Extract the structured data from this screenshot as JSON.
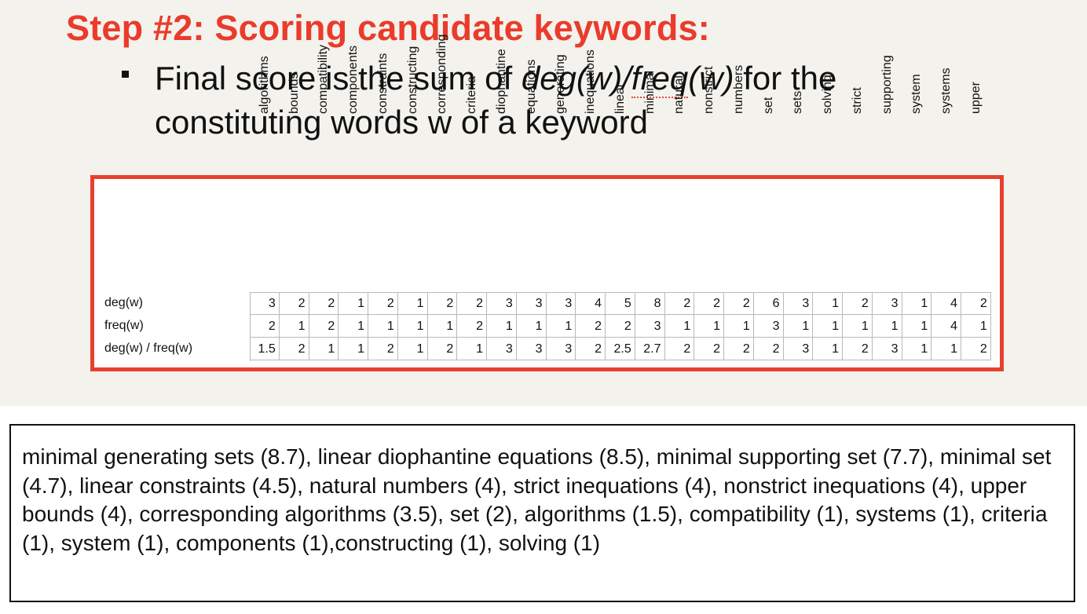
{
  "title": "Step #2: Scoring candidate keywords:",
  "bullet": {
    "prefix": "Final score is the sum of ",
    "formula_a": "deg(w)/",
    "formula_b": "freq",
    "formula_c": "(w)",
    "suffix_line1": " for the",
    "line2": "constituting words w of a keyword"
  },
  "table": {
    "row_labels": [
      "deg(w)",
      "freq(w)",
      "deg(w) / freq(w)"
    ],
    "columns": [
      "algorithms",
      "bounds",
      "compatibility",
      "components",
      "constraints",
      "constructing",
      "corresponding",
      "criteria",
      "diophantine",
      "equations",
      "generating",
      "inequations",
      "linear",
      "minimal",
      "natural",
      "nonstrict",
      "numbers",
      "set",
      "sets",
      "solving",
      "strict",
      "supporting",
      "system",
      "systems",
      "upper"
    ],
    "deg": [
      "3",
      "2",
      "2",
      "1",
      "2",
      "1",
      "2",
      "2",
      "3",
      "3",
      "3",
      "4",
      "5",
      "8",
      "2",
      "2",
      "2",
      "6",
      "3",
      "1",
      "2",
      "3",
      "1",
      "4",
      "2"
    ],
    "freq": [
      "2",
      "1",
      "2",
      "1",
      "1",
      "1",
      "1",
      "2",
      "1",
      "1",
      "1",
      "2",
      "2",
      "3",
      "1",
      "1",
      "1",
      "3",
      "1",
      "1",
      "1",
      "1",
      "1",
      "4",
      "1"
    ],
    "ratio": [
      "1.5",
      "2",
      "1",
      "1",
      "2",
      "1",
      "2",
      "1",
      "3",
      "3",
      "3",
      "2",
      "2.5",
      "2.7",
      "2",
      "2",
      "2",
      "2",
      "3",
      "1",
      "2",
      "3",
      "1",
      "1",
      "2"
    ]
  },
  "result_text": "minimal generating sets (8.7), linear diophantine equations (8.5), minimal supporting set (7.7), minimal set (4.7), linear constraints (4.5), natural numbers (4), strict inequations (4), nonstrict inequations (4), upper bounds (4), corresponding algorithms (3.5), set (2), algorithms (1.5), compatibility (1), systems (1), criteria (1), system (1), components (1),constructing (1), solving (1)"
}
